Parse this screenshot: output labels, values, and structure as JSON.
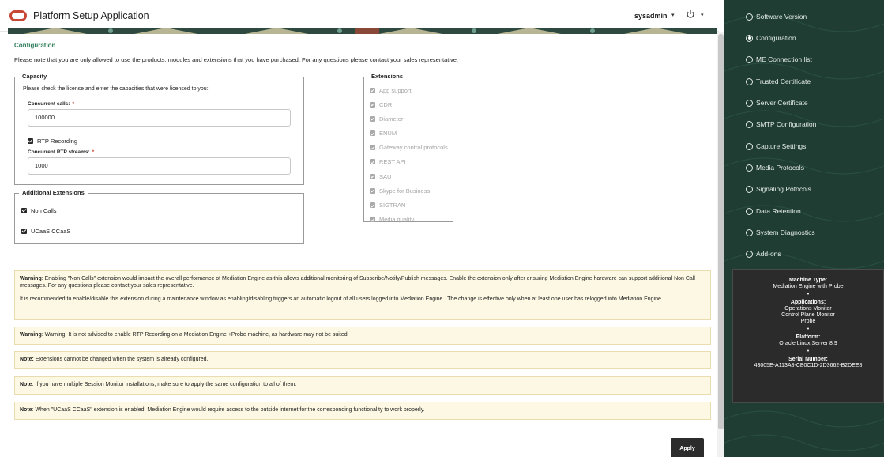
{
  "app": {
    "title": "Platform Setup Application",
    "user": "sysadmin",
    "caret": "▾"
  },
  "page": {
    "title": "Configuration",
    "intro": "Please note that you are only allowed to use the products, modules and extensions that you have purchased. For any questions please contact your sales representative."
  },
  "capacity": {
    "legend": "Capacity",
    "description": "Please check the license and enter the capacities that were licensed to you:",
    "concurrent_calls_label": "Concurrent calls:",
    "concurrent_calls_value": "100000",
    "rtp_recording_label": "RTP Recording",
    "rtp_recording_checked": true,
    "rtp_streams_label": "Concurrent RTP streams:",
    "rtp_streams_value": "1000",
    "required_mark": "*"
  },
  "additional_extensions": {
    "legend": "Additional Extensions",
    "items": [
      {
        "label": "Non Calls",
        "checked": true
      },
      {
        "label": "UCaaS CCaaS",
        "checked": true
      }
    ]
  },
  "extensions": {
    "legend": "Extensions",
    "items": [
      "App support",
      "CDR",
      "Diameter",
      "ENUM",
      "Gateway control protocols",
      "REST API",
      "SAU",
      "Skype for Business",
      "SIGTRAN",
      "Media quality"
    ]
  },
  "notices": {
    "warning1_label": "Warning",
    "warning1_text": ": Enabling \"Non Calls\" extension would impact the overall performance of Mediation Engine as this allows additional monitoring of Subscribe/Notify/Publish messages. Enable the extension only after ensuring Mediation Engine hardware can support additional Non Call messages. For any questions please contact your sales representative.",
    "warning1_text2": "It is recommended to enable/disable this extension during a maintenance window as enabling/disabling triggers an automatic logout of all users logged into Mediation Engine . The change is effective only when at least one user has relogged into Mediation Engine .",
    "warning2_label": "Warning",
    "warning2_text": ": Warning: It is not advised to enable RTP Recording on a Mediation Engine +Probe machine, as hardware may not be suited.",
    "note1_label": "Note:",
    "note1_text": " Extensions cannot be changed when the system is already configured..",
    "note2_label": "Note",
    "note2_text": ": If you have multiple Session Monitor installations, make sure to apply the same configuration to all of them.",
    "note3_label": "Note",
    "note3_text": ": When \"UCaaS CCaaS\" extension is enabled, Mediation Engine would require access to the outside internet for the corresponding functionality to work properly."
  },
  "apply_label": "Apply",
  "sidebar": {
    "items": [
      {
        "label": "Software Version",
        "selected": false
      },
      {
        "label": "Configuration",
        "selected": true
      },
      {
        "label": "ME Connection list",
        "selected": false
      },
      {
        "label": "Trusted Certificate",
        "selected": false
      },
      {
        "label": "Server Certificate",
        "selected": false
      },
      {
        "label": "SMTP Configuration",
        "selected": false
      },
      {
        "label": "Capture Settings",
        "selected": false
      },
      {
        "label": "Media Protocols",
        "selected": false
      },
      {
        "label": "Signaling Potocols",
        "selected": false
      },
      {
        "label": "Data Retention",
        "selected": false
      },
      {
        "label": "System Diagnostics",
        "selected": false
      },
      {
        "label": "Add-ons",
        "selected": false
      }
    ]
  },
  "machine": {
    "type_label": "Machine Type:",
    "type_value": "Mediation Engine with Probe",
    "applications_label": "Applications:",
    "applications": [
      "Operations Monitor",
      "Control Plane Monitor",
      "Probe"
    ],
    "platform_label": "Platform:",
    "platform_value": "Oracle Linux Server 8.9",
    "serial_label": "Serial Number:",
    "serial_value": "43005E-A113A8-CB0C1D-2D3662-B2DEE8",
    "separator": "•"
  },
  "colors": {
    "brand": "#c74634",
    "accent_green": "#2f7d5b",
    "sidebar_bg": "#1f3d33",
    "notice_bg": "#fcf8e3"
  },
  "icons": {
    "logo": "oracle-logo",
    "power": "power-icon",
    "check": "checkbox-checked-icon",
    "radio": "radio-icon"
  }
}
